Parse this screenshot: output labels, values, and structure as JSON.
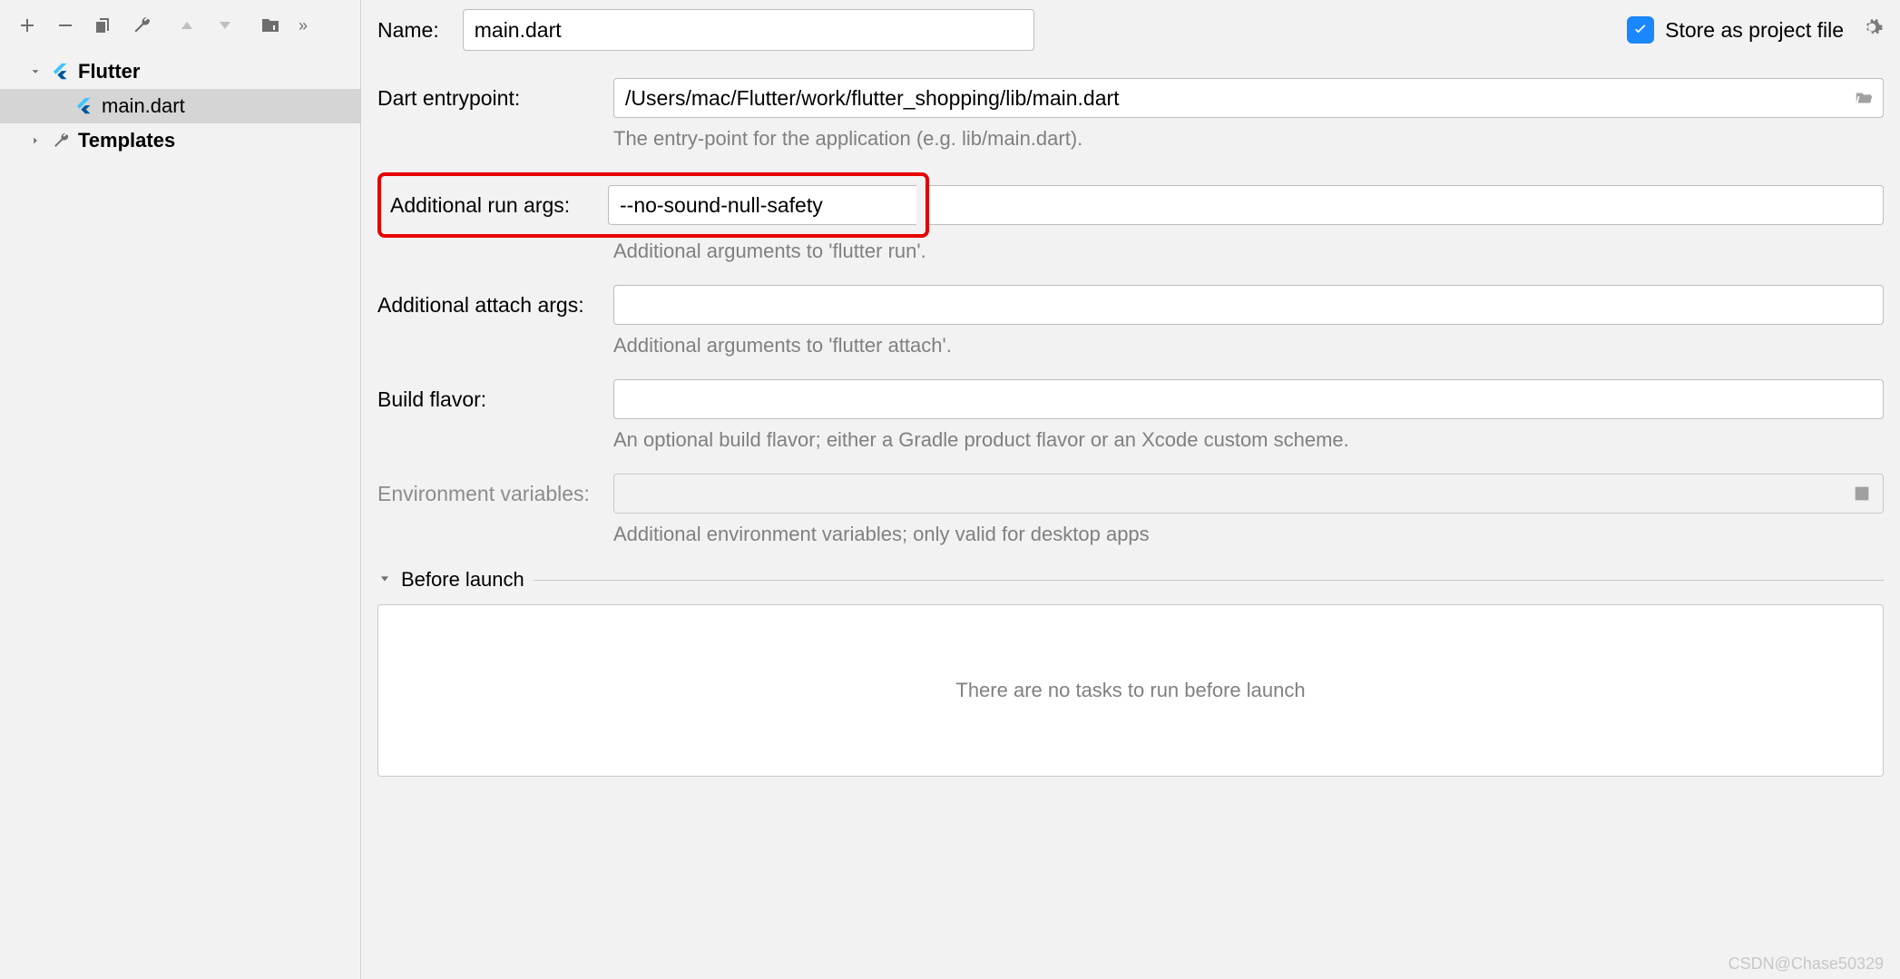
{
  "sidebar": {
    "items": [
      {
        "label": "Flutter",
        "icon": "flutter"
      },
      {
        "label": "main.dart",
        "icon": "flutter"
      },
      {
        "label": "Templates",
        "icon": "wrench"
      }
    ]
  },
  "form": {
    "name_label": "Name:",
    "name_value": "main.dart",
    "store_label": "Store as project file",
    "entrypoint_label": "Dart entrypoint:",
    "entrypoint_value": "/Users/mac/Flutter/work/flutter_shopping/lib/main.dart",
    "entrypoint_hint": "The entry-point for the application (e.g. lib/main.dart).",
    "run_args_label": "Additional run args:",
    "run_args_value": "--no-sound-null-safety",
    "run_args_hint": "Additional arguments to 'flutter run'.",
    "attach_args_label": "Additional attach args:",
    "attach_args_value": "",
    "attach_args_hint": "Additional arguments to 'flutter attach'.",
    "build_flavor_label": "Build flavor:",
    "build_flavor_value": "",
    "build_flavor_hint": "An optional build flavor; either a Gradle product flavor or an Xcode custom scheme.",
    "env_label": "Environment variables:",
    "env_hint": "Additional environment variables; only valid for desktop apps"
  },
  "before_launch": {
    "title": "Before launch",
    "empty": "There are no tasks to run before launch"
  },
  "watermark": "CSDN@Chase50329"
}
